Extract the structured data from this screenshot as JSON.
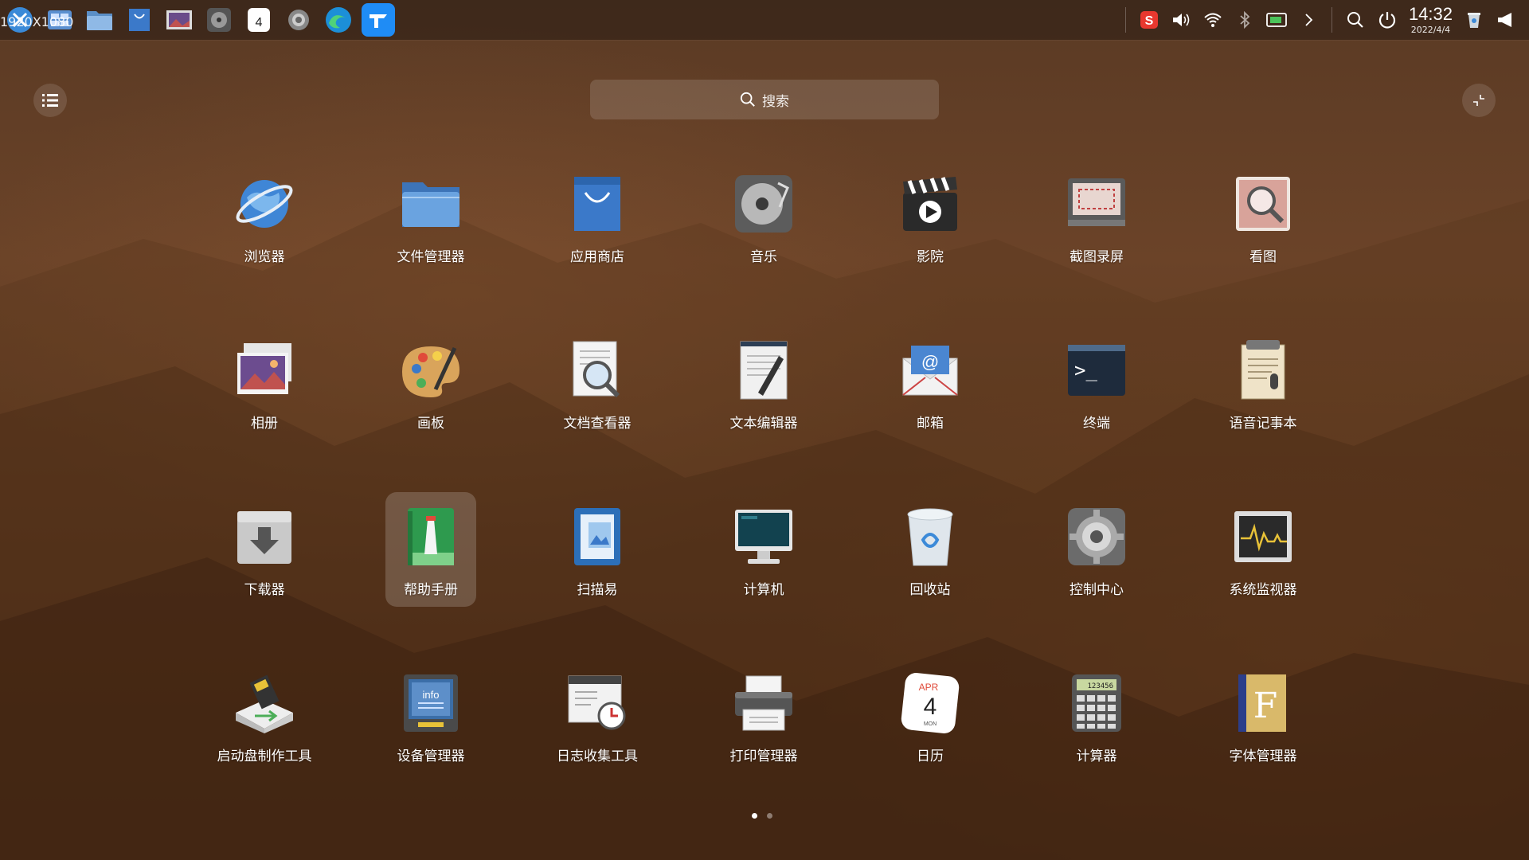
{
  "taskbar": {
    "resolution_text": "1920X1080",
    "apps": [
      {
        "name": "launcher-icon"
      },
      {
        "name": "multitask-view-icon"
      },
      {
        "name": "file-manager-icon"
      },
      {
        "name": "app-store-icon"
      },
      {
        "name": "photo-album-icon"
      },
      {
        "name": "music-icon"
      },
      {
        "name": "calendar-icon"
      },
      {
        "name": "settings-icon"
      },
      {
        "name": "edge-browser-icon"
      },
      {
        "name": "todesk-icon"
      }
    ],
    "calendar_day": "4",
    "tray": [
      "sogou-input-icon",
      "volume-icon",
      "wifi-icon",
      "bluetooth-icon",
      "display-icon",
      "expand-arrow-icon",
      "search-icon",
      "power-icon"
    ],
    "clock_time": "14:32",
    "clock_date": "2022/4/4"
  },
  "search": {
    "placeholder": "搜索"
  },
  "apps": [
    {
      "label": "浏览器",
      "icon": "browser-icon"
    },
    {
      "label": "文件管理器",
      "icon": "folder-icon"
    },
    {
      "label": "应用商店",
      "icon": "shopping-bag-icon"
    },
    {
      "label": "音乐",
      "icon": "music-disc-icon"
    },
    {
      "label": "影院",
      "icon": "clapperboard-icon"
    },
    {
      "label": "截图录屏",
      "icon": "screenshot-icon"
    },
    {
      "label": "看图",
      "icon": "image-viewer-icon"
    },
    {
      "label": "相册",
      "icon": "photo-album-icon"
    },
    {
      "label": "画板",
      "icon": "palette-icon"
    },
    {
      "label": "文档查看器",
      "icon": "document-viewer-icon"
    },
    {
      "label": "文本编辑器",
      "icon": "text-editor-icon"
    },
    {
      "label": "邮箱",
      "icon": "mail-icon"
    },
    {
      "label": "终端",
      "icon": "terminal-icon"
    },
    {
      "label": "语音记事本",
      "icon": "voice-notes-icon"
    },
    {
      "label": "下载器",
      "icon": "downloader-icon"
    },
    {
      "label": "帮助手册",
      "icon": "help-manual-icon",
      "selected": true
    },
    {
      "label": "扫描易",
      "icon": "scanner-icon"
    },
    {
      "label": "计算机",
      "icon": "computer-icon"
    },
    {
      "label": "回收站",
      "icon": "trash-icon"
    },
    {
      "label": "控制中心",
      "icon": "control-center-icon"
    },
    {
      "label": "系统监视器",
      "icon": "system-monitor-icon"
    },
    {
      "label": "启动盘制作工具",
      "icon": "boot-maker-icon"
    },
    {
      "label": "设备管理器",
      "icon": "device-manager-icon"
    },
    {
      "label": "日志收集工具",
      "icon": "log-collector-icon"
    },
    {
      "label": "打印管理器",
      "icon": "printer-icon"
    },
    {
      "label": "日历",
      "icon": "calendar-icon"
    },
    {
      "label": "计算器",
      "icon": "calculator-icon"
    },
    {
      "label": "字体管理器",
      "icon": "font-manager-icon"
    }
  ],
  "calendar_icon": {
    "month": "APR",
    "day": "4",
    "weekday": "MON"
  },
  "calculator_display": "123456",
  "font_letter": "F",
  "mail_symbol": "@",
  "terminal_prompt": ">_",
  "info_text": "info",
  "pager": {
    "pages": 2,
    "current": 1
  }
}
